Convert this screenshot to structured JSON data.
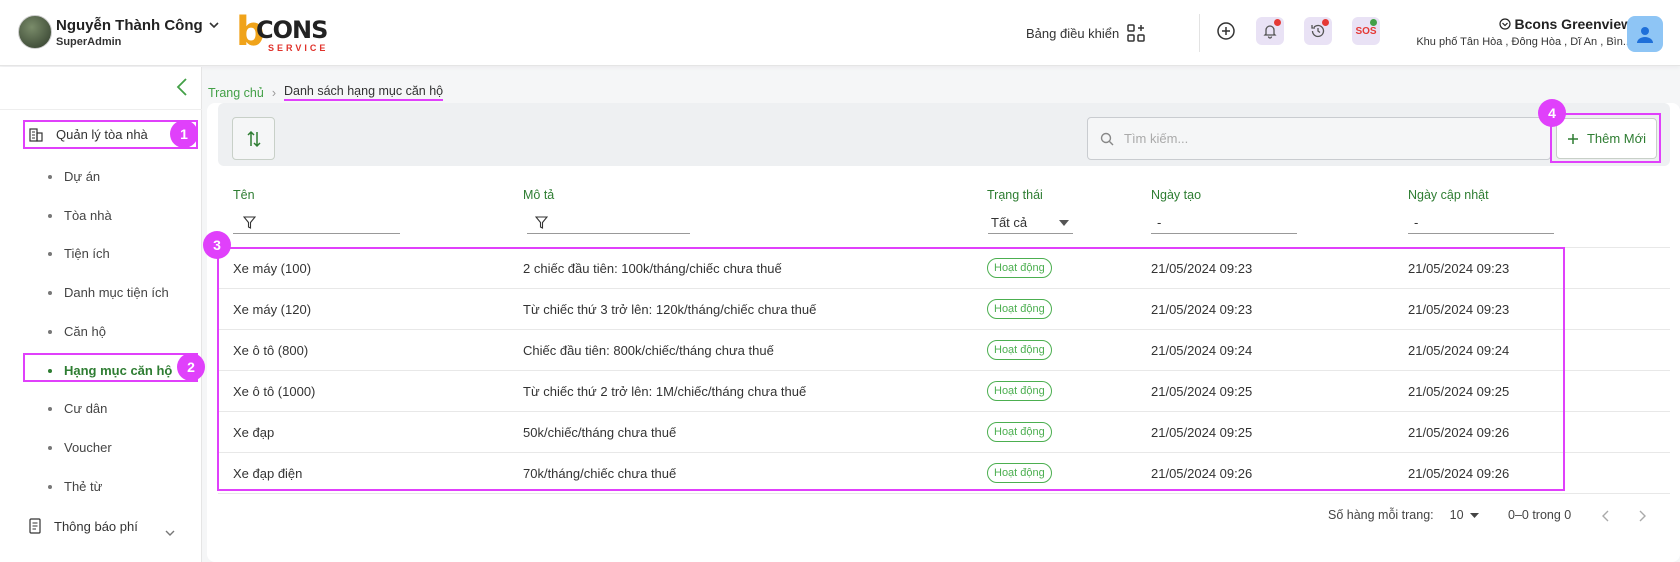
{
  "header": {
    "user_name": "Nguyễn Thành Công",
    "user_role": "SuperAdmin",
    "logo_top": "CONS",
    "logo_bottom": "SERVICE",
    "dashboard_label": "Bảng điều khiển",
    "sos_label": "SOS",
    "building_name": "Bcons Greenview",
    "building_address": "Khu phố Tân Hòa , Đông Hòa , Dĩ An , Bìn...",
    "colors": {
      "accent": "#2e7d32",
      "annotation": "#e040fb",
      "alert": "#e53935"
    }
  },
  "sidebar": {
    "group_label": "Quản lý tòa nhà",
    "items": [
      {
        "label": "Dự án"
      },
      {
        "label": "Tòa nhà"
      },
      {
        "label": "Tiện ích"
      },
      {
        "label": "Danh mục tiện ích"
      },
      {
        "label": "Căn hộ"
      },
      {
        "label": "Hạng mục căn hộ"
      },
      {
        "label": "Cư dân"
      },
      {
        "label": "Voucher"
      },
      {
        "label": "Thẻ từ"
      }
    ],
    "notification_group_label": "Thông báo phí"
  },
  "breadcrumb": {
    "home": "Trang chủ",
    "current": "Danh sách hạng mục căn hộ"
  },
  "toolbar": {
    "search_placeholder": "Tìm kiếm...",
    "add_label": "Thêm Mới"
  },
  "table": {
    "columns": {
      "name": "Tên",
      "description": "Mô tả",
      "status": "Trạng thái",
      "created": "Ngày tạo",
      "updated": "Ngày cập nhật"
    },
    "status_filter_value": "Tất cả",
    "date_filter_placeholder": "-",
    "rows": [
      {
        "name": "Xe máy (100)",
        "description": "2 chiếc đầu tiên: 100k/tháng/chiếc chưa thuế",
        "status": "Hoạt động",
        "created": "21/05/2024 09:23",
        "updated": "21/05/2024 09:23"
      },
      {
        "name": "Xe máy (120)",
        "description": "Từ chiếc thứ 3 trở lên: 120k/tháng/chiếc chưa thuế",
        "status": "Hoạt động",
        "created": "21/05/2024 09:23",
        "updated": "21/05/2024 09:23"
      },
      {
        "name": "Xe ô tô (800)",
        "description": "Chiếc đầu tiên: 800k/chiếc/tháng chưa thuế",
        "status": "Hoạt động",
        "created": "21/05/2024 09:24",
        "updated": "21/05/2024 09:24"
      },
      {
        "name": "Xe ô tô (1000)",
        "description": "Từ chiếc thứ 2 trở lên: 1M/chiếc/tháng chưa thuế",
        "status": "Hoạt động",
        "created": "21/05/2024 09:25",
        "updated": "21/05/2024 09:25"
      },
      {
        "name": "Xe đạp",
        "description": "50k/chiếc/tháng chưa thuế",
        "status": "Hoạt động",
        "created": "21/05/2024 09:25",
        "updated": "21/05/2024 09:26"
      },
      {
        "name": "Xe đạp điện",
        "description": "70k/tháng/chiếc chưa thuế",
        "status": "Hoạt động",
        "created": "21/05/2024 09:26",
        "updated": "21/05/2024 09:26"
      }
    ]
  },
  "pagination": {
    "rows_per_page_label": "Số hàng mỗi trang:",
    "rows_per_page": "10",
    "range": "0–0 trong 0"
  },
  "annotations": [
    "1",
    "2",
    "3",
    "4"
  ]
}
